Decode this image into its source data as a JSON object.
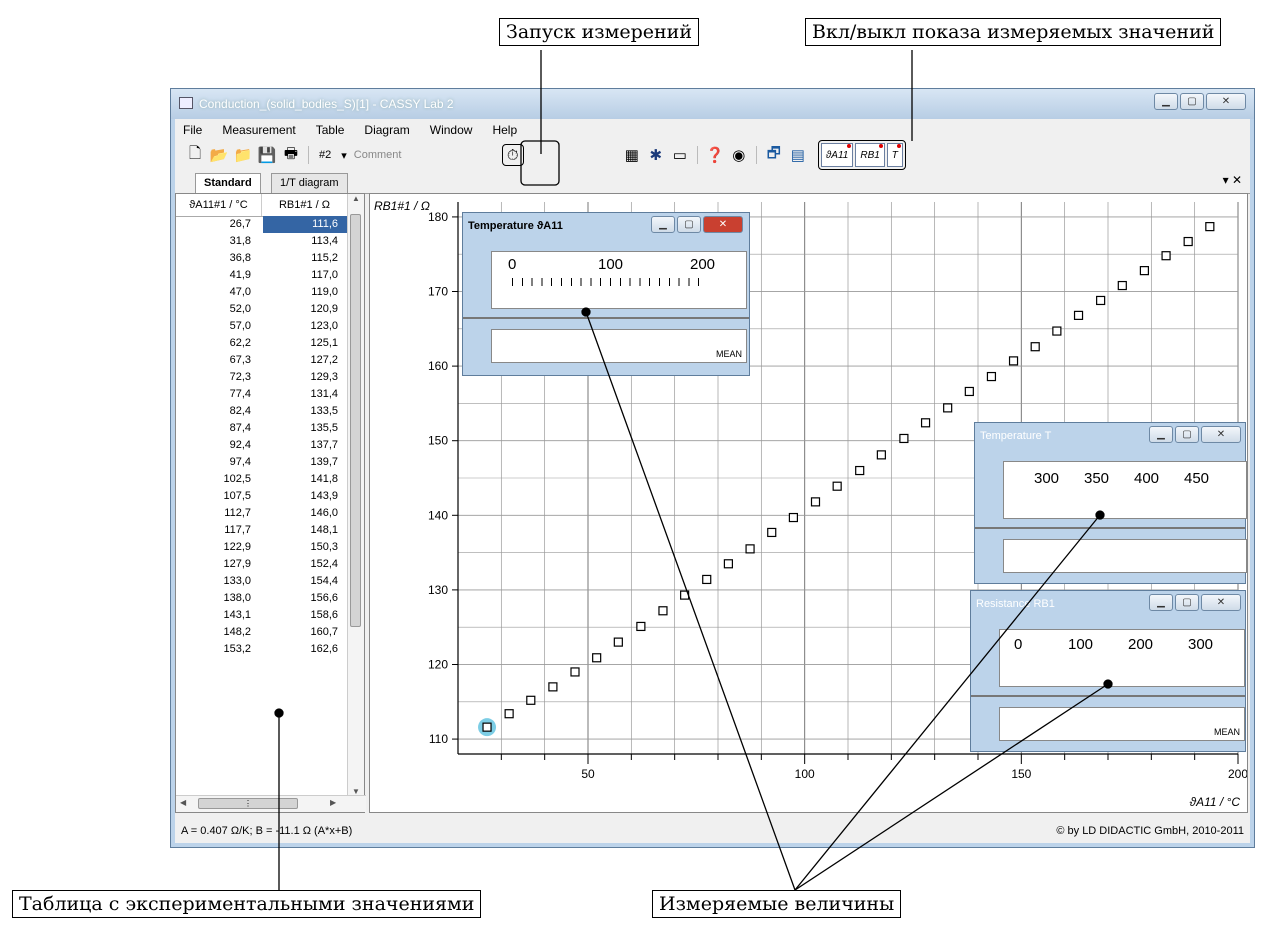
{
  "callouts": {
    "start_measurement": "Запуск измерений",
    "toggle_display": "Вкл/выкл показа измеряемых значений",
    "table": "Таблица с экспериментальными значениями",
    "quantities": "Измеряемые величины"
  },
  "window": {
    "title": "Conduction_(solid_bodies_S)[1] - CASSY Lab 2",
    "menu": [
      "File",
      "Measurement",
      "Table",
      "Diagram",
      "Window",
      "Help"
    ],
    "toolbar": {
      "dataset": "#2",
      "comment_placeholder": "Comment"
    },
    "measurement_buttons": [
      "ϑA11",
      "RB1",
      "T"
    ],
    "tabs": [
      "Standard",
      "1/T diagram"
    ],
    "status_left": "A = 0.407 Ω/K;  B = -11.1 Ω  (A*x+B)",
    "status_right": "© by LD DIDACTIC GmbH, 2010-2011"
  },
  "table": {
    "headers": [
      "ϑA11#1 / °C",
      "RB1#1 / Ω"
    ],
    "rows": [
      [
        "26,7",
        "111,6"
      ],
      [
        "31,8",
        "113,4"
      ],
      [
        "36,8",
        "115,2"
      ],
      [
        "41,9",
        "117,0"
      ],
      [
        "47,0",
        "119,0"
      ],
      [
        "52,0",
        "120,9"
      ],
      [
        "57,0",
        "123,0"
      ],
      [
        "62,2",
        "125,1"
      ],
      [
        "67,3",
        "127,2"
      ],
      [
        "72,3",
        "129,3"
      ],
      [
        "77,4",
        "131,4"
      ],
      [
        "82,4",
        "133,5"
      ],
      [
        "87,4",
        "135,5"
      ],
      [
        "92,4",
        "137,7"
      ],
      [
        "97,4",
        "139,7"
      ],
      [
        "102,5",
        "141,8"
      ],
      [
        "107,5",
        "143,9"
      ],
      [
        "112,7",
        "146,0"
      ],
      [
        "117,7",
        "148,1"
      ],
      [
        "122,9",
        "150,3"
      ],
      [
        "127,9",
        "152,4"
      ],
      [
        "133,0",
        "154,4"
      ],
      [
        "138,0",
        "156,6"
      ],
      [
        "143,1",
        "158,6"
      ],
      [
        "148,2",
        "160,7"
      ],
      [
        "153,2",
        "162,6"
      ]
    ],
    "selected_cell": "111,6"
  },
  "chart_data": {
    "type": "scatter",
    "title": "",
    "xlabel": "ϑA11 / °C",
    "ylabel": "RB1#1 / Ω",
    "xlim": [
      20,
      200
    ],
    "ylim": [
      108,
      182
    ],
    "xticks": [
      50,
      100,
      150,
      200
    ],
    "yticks": [
      110,
      120,
      130,
      140,
      150,
      160,
      170,
      180
    ],
    "grid": true,
    "points": [
      [
        26.7,
        111.6
      ],
      [
        31.8,
        113.4
      ],
      [
        36.8,
        115.2
      ],
      [
        41.9,
        117.0
      ],
      [
        47.0,
        119.0
      ],
      [
        52.0,
        120.9
      ],
      [
        57.0,
        123.0
      ],
      [
        62.2,
        125.1
      ],
      [
        67.3,
        127.2
      ],
      [
        72.3,
        129.3
      ],
      [
        77.4,
        131.4
      ],
      [
        82.4,
        133.5
      ],
      [
        87.4,
        135.5
      ],
      [
        92.4,
        137.7
      ],
      [
        97.4,
        139.7
      ],
      [
        102.5,
        141.8
      ],
      [
        107.5,
        143.9
      ],
      [
        112.7,
        146.0
      ],
      [
        117.7,
        148.1
      ],
      [
        122.9,
        150.3
      ],
      [
        127.9,
        152.4
      ],
      [
        133.0,
        154.4
      ],
      [
        138.0,
        156.6
      ],
      [
        143.1,
        158.6
      ],
      [
        148.2,
        160.7
      ],
      [
        153.2,
        162.6
      ],
      [
        158.2,
        164.7
      ],
      [
        163.2,
        166.8
      ],
      [
        168.3,
        168.8
      ],
      [
        173.3,
        170.8
      ],
      [
        178.4,
        172.8
      ],
      [
        183.4,
        174.8
      ],
      [
        188.5,
        176.7
      ],
      [
        193.5,
        178.7
      ]
    ],
    "highlight_index": 0
  },
  "instruments": {
    "temp_a11": {
      "title": "Temperature ϑA11",
      "ticks": [
        "0",
        "100",
        "200"
      ],
      "mode": "MEAN"
    },
    "temp_t": {
      "title": "Temperature T",
      "ticks": [
        "300",
        "350",
        "400",
        "450"
      ]
    },
    "resistance": {
      "title": "Resistance RB1",
      "ticks": [
        "0",
        "100",
        "200",
        "300"
      ],
      "mode": "MEAN"
    }
  }
}
